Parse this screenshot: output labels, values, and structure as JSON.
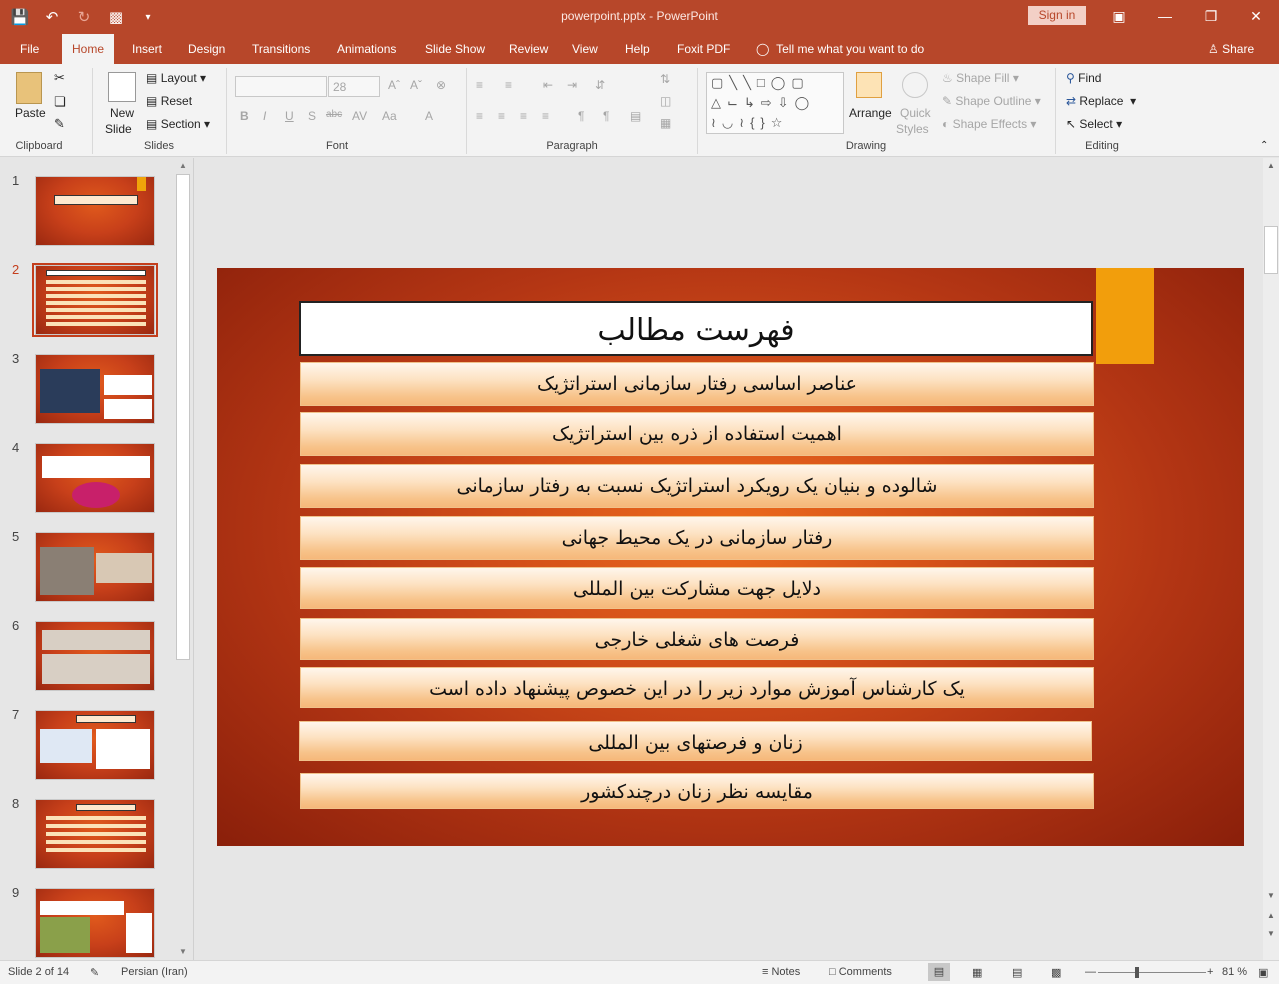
{
  "titlebar": {
    "document_title": "powerpoint.pptx  -  PowerPoint",
    "signin_label": "Sign in"
  },
  "tabs": [
    "File",
    "Home",
    "Insert",
    "Design",
    "Transitions",
    "Animations",
    "Slide Show",
    "Review",
    "View",
    "Help",
    "Foxit PDF"
  ],
  "tell_me": "Tell me what you want to do",
  "share_label": "Share",
  "ribbon": {
    "clipboard": {
      "label": "Clipboard",
      "paste": "Paste"
    },
    "slides": {
      "label": "Slides",
      "new_slide_line1": "New",
      "new_slide_line2": "Slide",
      "layout": "Layout",
      "reset": "Reset",
      "section": "Section"
    },
    "font": {
      "label": "Font",
      "font_size": "28"
    },
    "paragraph": {
      "label": "Paragraph"
    },
    "drawing": {
      "label": "Drawing",
      "arrange": "Arrange",
      "quick_styles_line1": "Quick",
      "quick_styles_line2": "Styles",
      "shape_fill": "Shape Fill",
      "shape_outline": "Shape Outline",
      "shape_effects": "Shape Effects"
    },
    "editing": {
      "label": "Editing",
      "find": "Find",
      "replace": "Replace",
      "select": "Select"
    }
  },
  "thumbnails": {
    "numbers": [
      "1",
      "2",
      "3",
      "4",
      "5",
      "6",
      "7",
      "8",
      "9"
    ],
    "selected": "2"
  },
  "slide": {
    "title": "فهرست مطالب",
    "items": [
      "عناصر اساسی رفتار سازمانی استراتژیک",
      "اهمیت استفاده از ذره بین استراتژیک",
      "شالوده و بنیان یک رویکرد استراتژیک نسبت به رفتار سازمانی",
      "رفتار سازمانی در یک محیط جهانی",
      "دلایل جهت مشارکت بین المللی",
      "فرصت های شغلی خارجی",
      "یک کارشناس آموزش موارد زیر را در این خصوص پیشنهاد داده است",
      "زنان و فرصتهای بین المللی",
      "مقایسه نظر زنان درچندکشور"
    ]
  },
  "statusbar": {
    "slide_info": "Slide 2 of 14",
    "language": "Persian (Iran)",
    "notes": "Notes",
    "comments": "Comments",
    "zoom": "81 %"
  },
  "colors": {
    "accent": "#b7472a",
    "slide_accent": "#f29e0c"
  }
}
